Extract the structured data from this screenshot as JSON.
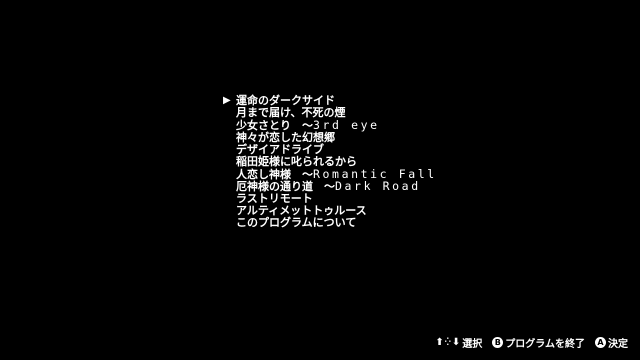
{
  "menu": {
    "cursor_glyph": "▶",
    "items": [
      {
        "jp": "運命のダークサイド",
        "latin": ""
      },
      {
        "jp": "月まで届け、不死の煙",
        "latin": ""
      },
      {
        "jp": "少女さとり　～",
        "latin": "3rd eye"
      },
      {
        "jp": "神々が恋した幻想郷",
        "latin": ""
      },
      {
        "jp": "デザイアドライブ",
        "latin": ""
      },
      {
        "jp": "稲田姫様に叱られるから",
        "latin": ""
      },
      {
        "jp": "人恋し神様　～",
        "latin": "Romantic Fall"
      },
      {
        "jp": "厄神様の通り道　～",
        "latin": "Dark Road"
      },
      {
        "jp": "ラストリモート",
        "latin": ""
      },
      {
        "jp": "アルティメットトゥルース",
        "latin": ""
      },
      {
        "jp": "このプログラムについて",
        "latin": ""
      }
    ],
    "selected_index": 0
  },
  "footer": {
    "dpad_up": "⬆",
    "dpad_mid": "⁛",
    "dpad_down": "⬇",
    "select_label": "選択",
    "b_glyph": "B",
    "exit_label": "プログラムを終了",
    "a_glyph": "A",
    "confirm_label": "決定"
  },
  "colors": {
    "background": "#000000",
    "text": "#ffffff"
  },
  "icons": {
    "cursor": "triangle-right-icon",
    "dpad": "dpad-up-down-icon",
    "b_button": "b-button-icon",
    "a_button": "a-button-icon"
  }
}
